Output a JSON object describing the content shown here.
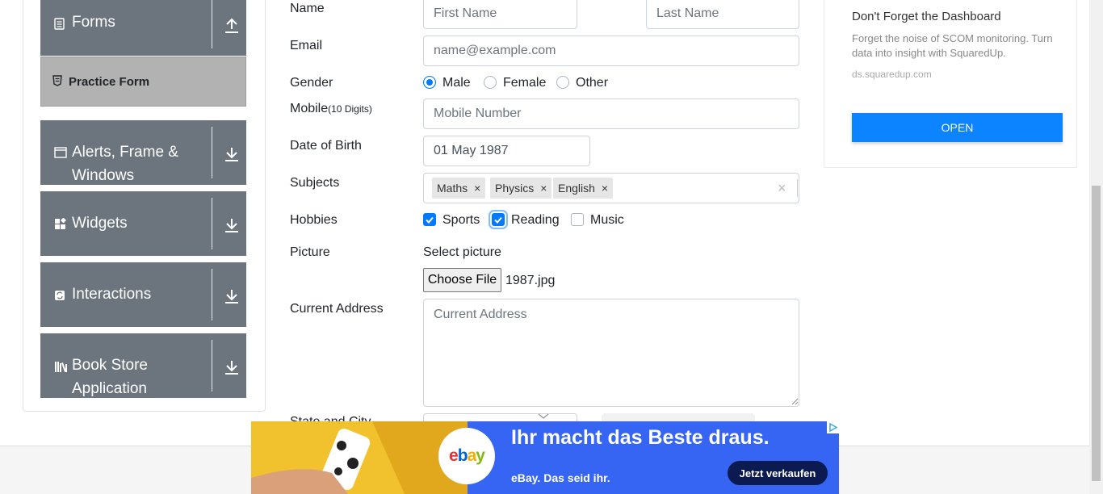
{
  "sidebar": {
    "groups": [
      {
        "label": "Forms",
        "icon": "document-icon",
        "arrow": "upload-icon"
      },
      {
        "label_line1": "Alerts, Frame &",
        "label_line2": "Windows",
        "icon": "window-icon",
        "arrow": "download-icon"
      },
      {
        "label": "Widgets",
        "icon": "widgets-icon",
        "arrow": "download-icon"
      },
      {
        "label": "Interactions",
        "icon": "interactions-icon",
        "arrow": "download-icon"
      },
      {
        "label_line1": "Book Store",
        "label_line2": "Application",
        "icon": "books-icon",
        "arrow": "download-icon"
      }
    ],
    "active_item": {
      "label": "Practice Form",
      "icon": "html5-icon"
    },
    "group_color": "#6c757d",
    "active_color": "#b2b2b2"
  },
  "form": {
    "name_label": "Name",
    "first_name_placeholder": "First Name",
    "last_name_placeholder": "Last Name",
    "email_label": "Email",
    "email_placeholder": "name@example.com",
    "gender_label": "Gender",
    "gender_options": [
      "Male",
      "Female",
      "Other"
    ],
    "gender_selected": "Male",
    "mobile_label": "Mobile",
    "mobile_hint": "(10 Digits)",
    "mobile_placeholder": "Mobile Number",
    "dob_label": "Date of Birth",
    "dob_value": "01 May 1987",
    "subjects_label": "Subjects",
    "subjects": [
      "Maths",
      "Physics",
      "English"
    ],
    "hobbies_label": "Hobbies",
    "hobbies": [
      {
        "label": "Sports",
        "checked": true
      },
      {
        "label": "Reading",
        "checked": true
      },
      {
        "label": "Music",
        "checked": false
      }
    ],
    "picture_label": "Picture",
    "select_picture_text": "Select picture",
    "choose_file_label": "Choose File",
    "file_name": "1987.jpg",
    "address_label": "Current Address",
    "address_placeholder": "Current Address",
    "state_city_label": "State and City"
  },
  "ad_card": {
    "title": "Don't Forget the Dashboard",
    "description": "Forget the noise of SCOM monitoring. Turn data into insight with SquaredUp.",
    "url": "ds.squaredup.com",
    "button": "OPEN",
    "button_color": "#0d84ff"
  },
  "banner": {
    "logo": "ebay",
    "headline": "Ihr macht das Beste draus.",
    "subline": "eBay. Das seid ihr.",
    "cta": "Jetzt verkaufen",
    "background": "#3665f3"
  },
  "colors": {
    "accent": "#007bff"
  }
}
